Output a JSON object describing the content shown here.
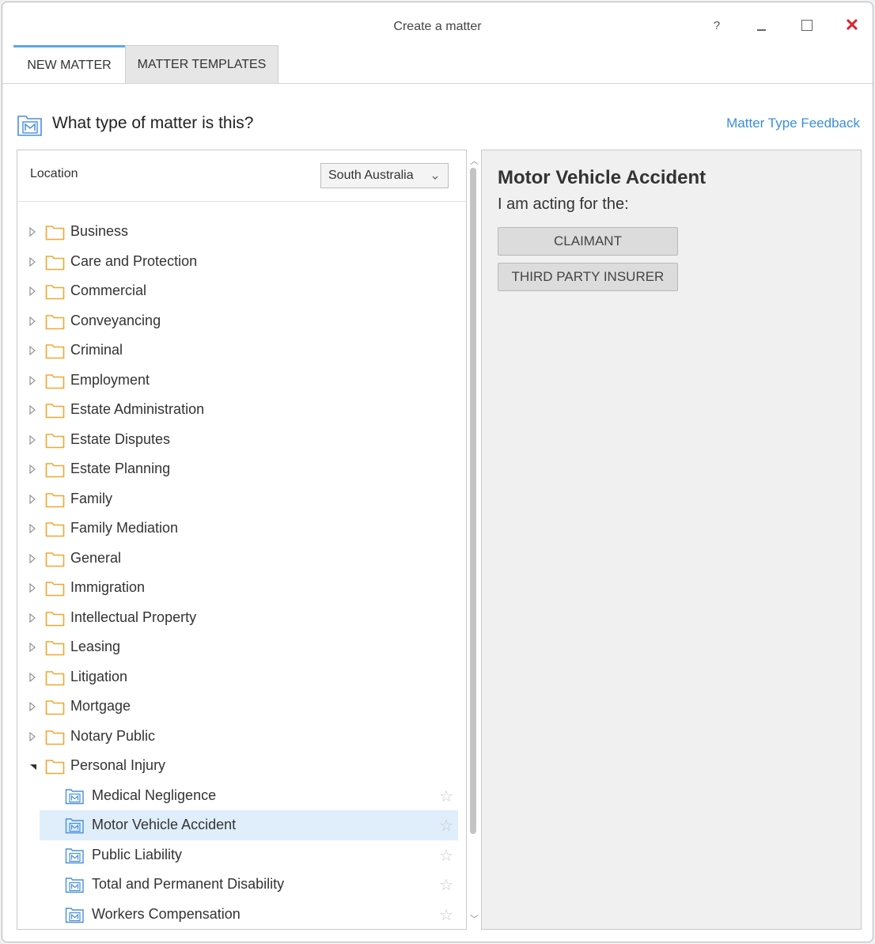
{
  "window": {
    "title": "Create a matter",
    "help_label": "?"
  },
  "tabs": [
    {
      "label": "NEW MATTER",
      "active": true
    },
    {
      "label": "MATTER TEMPLATES",
      "active": false
    }
  ],
  "header": {
    "question": "What type of matter is this?",
    "feedback_link": "Matter Type Feedback"
  },
  "location": {
    "label": "Location",
    "selected": "South Australia"
  },
  "tree": {
    "folders": [
      "Business",
      "Care and Protection",
      "Commercial",
      "Conveyancing",
      "Criminal",
      "Employment",
      "Estate Administration",
      "Estate Disputes",
      "Estate Planning",
      "Family",
      "Family Mediation",
      "General",
      "Immigration",
      "Intellectual Property",
      "Leasing",
      "Litigation",
      "Mortgage",
      "Notary Public"
    ],
    "expanded_folder": "Personal Injury",
    "children": [
      {
        "label": "Medical Negligence",
        "selected": false
      },
      {
        "label": "Motor Vehicle Accident",
        "selected": true
      },
      {
        "label": "Public Liability",
        "selected": false
      },
      {
        "label": "Total and Permanent Disability",
        "selected": false
      },
      {
        "label": "Workers Compensation",
        "selected": false
      }
    ]
  },
  "detail": {
    "title": "Motor Vehicle Accident",
    "subtitle": "I am acting for the:",
    "options": [
      "CLAIMANT",
      "THIRD PARTY INSURER"
    ]
  },
  "icons": {
    "folder": "folder-icon",
    "matter": "matter-icon",
    "star": "star-icon",
    "expand": "triangle-right-icon",
    "collapse": "triangle-down-icon"
  },
  "colors": {
    "accent": "#5aa7e8",
    "link": "#3a8fd8",
    "folder": "#f0a830",
    "selection": "#dfeefa",
    "close": "#d9232e"
  }
}
